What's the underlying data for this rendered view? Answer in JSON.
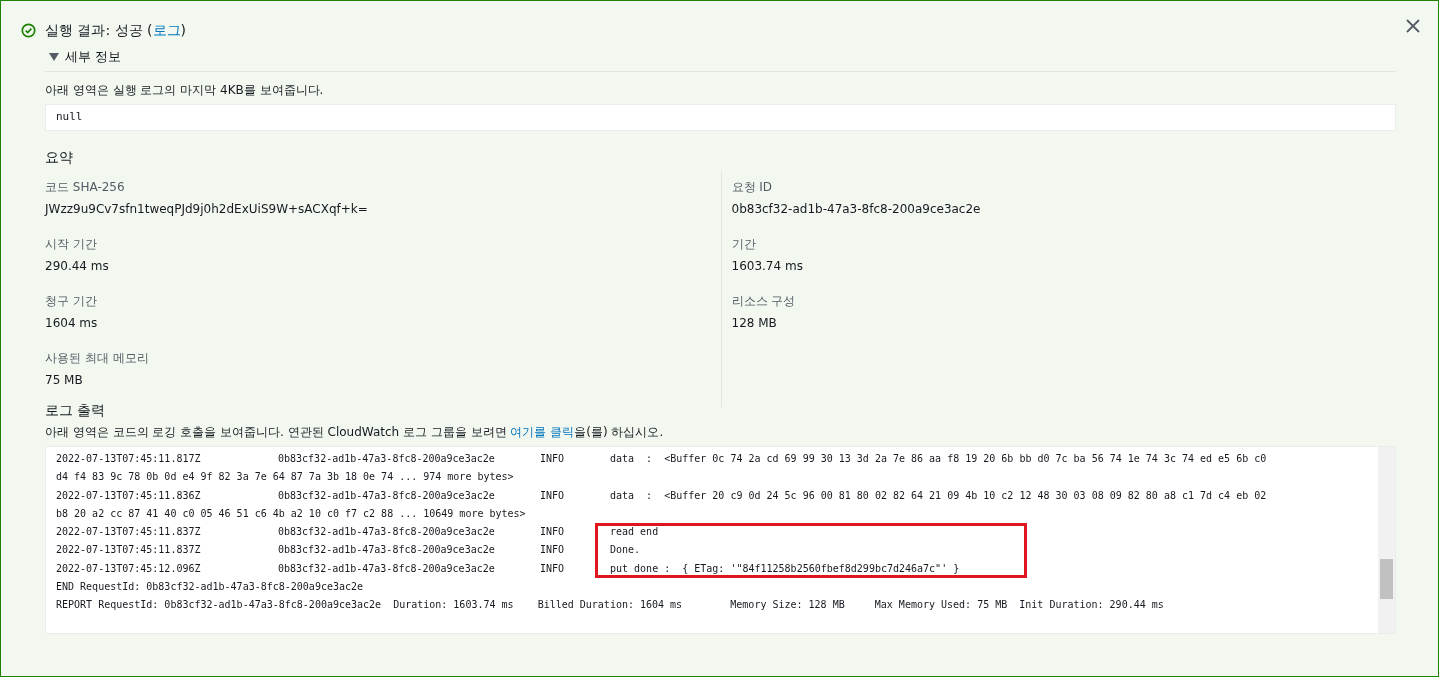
{
  "header": {
    "title": "실행 결과: 성공 (",
    "link": "로그",
    "title_end": ")",
    "succeeded": true
  },
  "details": {
    "label": "세부 정보",
    "expanded": true,
    "description": "아래 영역은 실행 로그의 마지막 4KB를 보여줍니다.",
    "output": "null"
  },
  "summary": {
    "title": "요약",
    "left": [
      {
        "label": "코드 SHA-256",
        "value": "JWzz9u9Cv7sfn1tweqPJd9j0h2dExUiS9W+sACXqf+k="
      },
      {
        "label": "시작 기간",
        "value": "290.44 ms"
      },
      {
        "label": "청구 기간",
        "value": "1604 ms"
      },
      {
        "label": "사용된 최대 메모리",
        "value": "75 MB"
      }
    ],
    "right": [
      {
        "label": "요청 ID",
        "value": "0b83cf32-ad1b-47a3-8fc8-200a9ce3ac2e"
      },
      {
        "label": "기간",
        "value": "1603.74 ms"
      },
      {
        "label": "리소스 구성",
        "value": "128 MB"
      }
    ]
  },
  "log_output": {
    "title": "로그 출력",
    "description_before": "아래 영역은 코드의 로깅 호출을 보여줍니다. 연관된 CloudWatch 로그 그룹을 보려면 ",
    "link": "여기를 클릭",
    "description_after": "을(를) 하십시오.",
    "lines": [
      {
        "kind": "entry",
        "time": "2022-07-13T07:45:11.817Z",
        "request_id": "0b83cf32-ad1b-47a3-8fc8-200a9ce3ac2e",
        "level": "INFO",
        "message": "data  :  <Buffer 0c 74 2a cd 69 99 30 13 3d 2a 7e 86 aa f8 19 20 6b bb d0 7c ba 56 74 1e 74 3c 74 ed e5 6b c0",
        "highlighted": false
      },
      {
        "kind": "text",
        "text": "d4 f4 83 9c 78 0b 0d e4 9f 82 3a 7e 64 87 7a 3b 18 0e 74 ... 974 more bytes>"
      },
      {
        "kind": "entry",
        "time": "2022-07-13T07:45:11.836Z",
        "request_id": "0b83cf32-ad1b-47a3-8fc8-200a9ce3ac2e",
        "level": "INFO",
        "message": "data  :  <Buffer 20 c9 0d 24 5c 96 00 81 80 02 82 64 21 09 4b 10 c2 12 48 30 03 08 09 82 80 a8 c1 7d c4 eb 02",
        "highlighted": false
      },
      {
        "kind": "text",
        "text": "b8 20 a2 cc 87 41 40 c0 05 46 51 c6 4b a2 10 c0 f7 c2 88 ... 10649 more bytes>"
      },
      {
        "kind": "entry",
        "time": "2022-07-13T07:45:11.837Z",
        "request_id": "0b83cf32-ad1b-47a3-8fc8-200a9ce3ac2e",
        "level": "INFO",
        "message": "read end",
        "highlighted": true
      },
      {
        "kind": "entry",
        "time": "2022-07-13T07:45:11.837Z",
        "request_id": "0b83cf32-ad1b-47a3-8fc8-200a9ce3ac2e",
        "level": "INFO",
        "message": "Done.",
        "highlighted": true
      },
      {
        "kind": "entry",
        "time": "2022-07-13T07:45:12.096Z",
        "request_id": "0b83cf32-ad1b-47a3-8fc8-200a9ce3ac2e",
        "level": "INFO",
        "message": "put done :  { ETag: '\"84f11258b2560fbef8d299bc7d246a7c\"' }",
        "highlighted": true
      },
      {
        "kind": "text",
        "text": "END RequestId: 0b83cf32-ad1b-47a3-8fc8-200a9ce3ac2e"
      },
      {
        "kind": "text",
        "text": "REPORT RequestId: 0b83cf32-ad1b-47a3-8fc8-200a9ce3ac2e  Duration: 1603.74 ms    Billed Duration: 1604 ms        Memory Size: 128 MB     Max Memory Used: 75 MB  Init Duration: 290.44 ms"
      }
    ]
  }
}
